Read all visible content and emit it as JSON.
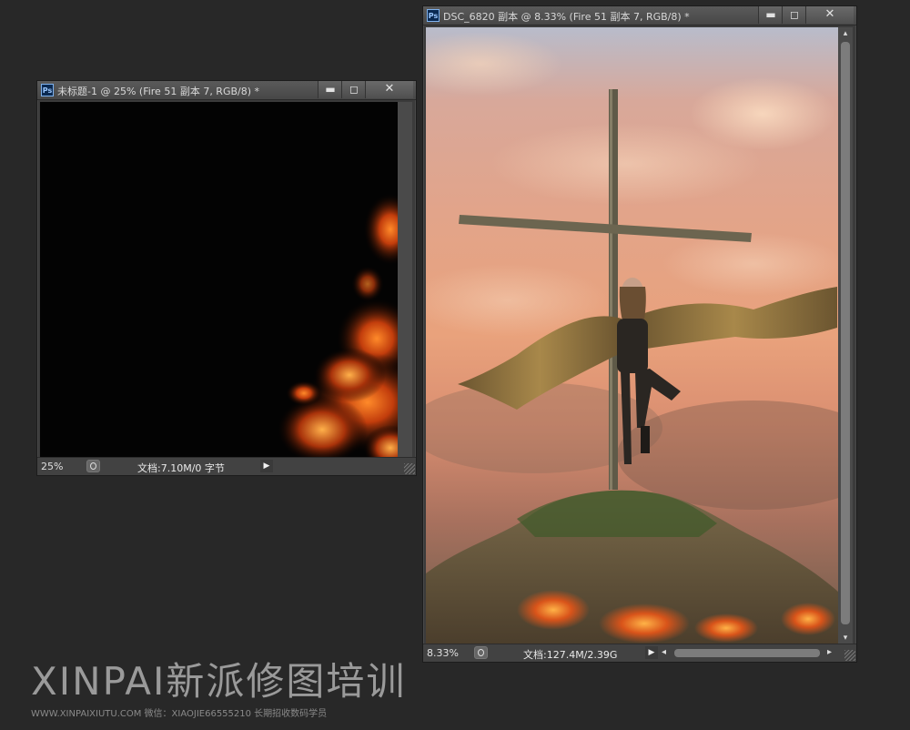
{
  "window1": {
    "title": "未标题-1 @ 25% (Fire 51 副本 7, RGB/8) *",
    "app_icon": "Ps",
    "controls": {
      "minimize": "▬",
      "maximize": "◻",
      "close": "✕"
    },
    "status": {
      "zoom": "25%",
      "doc_info": "文档:7.10M/0 字节",
      "menu_arrow": "▶"
    }
  },
  "window2": {
    "title": "DSC_6820 副本 @ 8.33% (Fire 51 副本 7, RGB/8) *",
    "app_icon": "Ps",
    "controls": {
      "minimize": "▬",
      "maximize": "◻",
      "close": "✕"
    },
    "status": {
      "zoom": "8.33%",
      "doc_info": "文档:127.4M/2.39G",
      "menu_arrow": "▶",
      "scroll_left": "◂",
      "scroll_right": "▸"
    },
    "vscroll": {
      "up": "▴",
      "down": "▾"
    }
  },
  "watermark": {
    "brand": "XINPAI新派修图培训",
    "subtitle": "WWW.XINPAIXIUTU.COM   微信：XIAOJIE66555210 长期招收数码学员"
  },
  "colors": {
    "workspace": "#282828",
    "titlebar": "#4f4f4f",
    "fire": "#d9541a"
  }
}
